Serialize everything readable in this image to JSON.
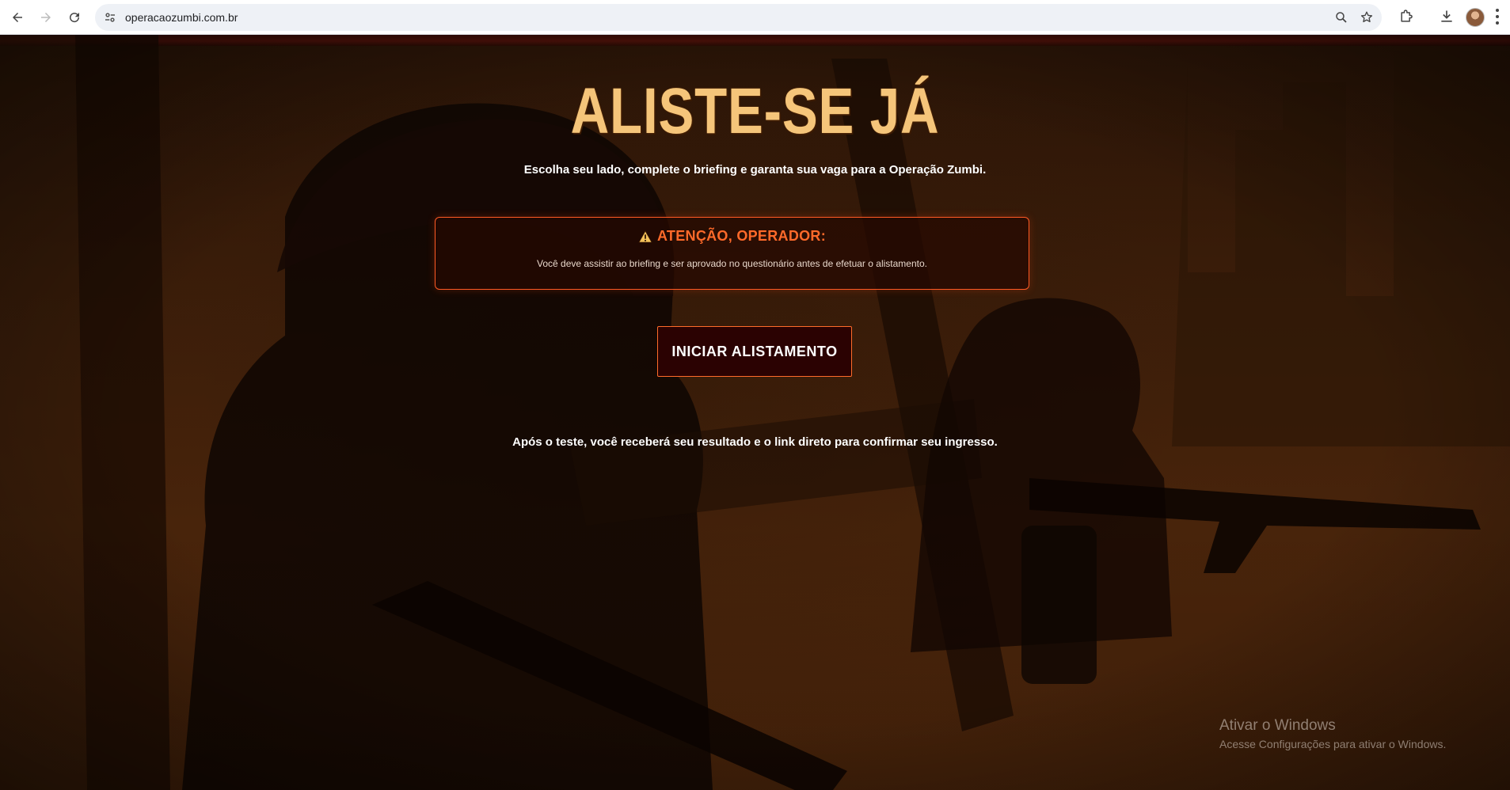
{
  "browser": {
    "url": "operacaozumbi.com.br"
  },
  "hero": {
    "title": "ALISTE-SE JÁ",
    "subtitle": "Escolha seu lado, complete o briefing e garanta sua vaga para a Operação Zumbi."
  },
  "alert": {
    "icon": "warning-icon",
    "title": "ATENÇÃO, OPERADOR:",
    "text": "Você deve assistir ao briefing e ser aprovado no questionário antes de efetuar o alistamento."
  },
  "cta": {
    "label": "INICIAR ALISTAMENTO"
  },
  "footer": {
    "note": "Após o teste, você receberá seu resultado e o link direto para confirmar seu ingresso."
  },
  "watermark": {
    "title": "Ativar o Windows",
    "subtitle": "Acesse Configurações para ativar o Windows."
  },
  "colors": {
    "accent": "#ff6a2a",
    "title": "#f5c57a",
    "button_bg": "#2b0202",
    "background": "#2a1407"
  }
}
